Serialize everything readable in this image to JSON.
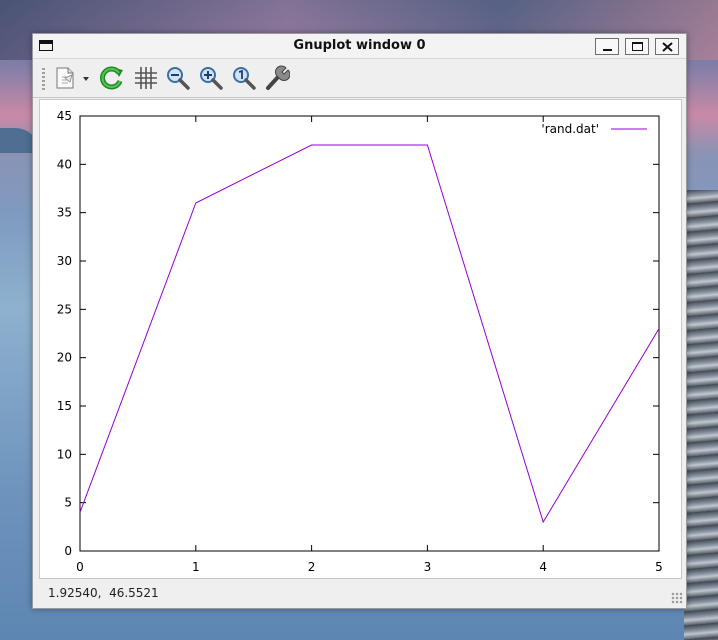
{
  "window": {
    "title": "Gnuplot window 0",
    "controls": [
      "minimize",
      "maximize",
      "close"
    ]
  },
  "toolbar": {
    "items": [
      {
        "name": "export-icon",
        "label": "Export"
      },
      {
        "name": "replot-icon",
        "label": "Replot"
      },
      {
        "name": "grid-icon",
        "label": "Grid"
      },
      {
        "name": "zoom-previous-icon",
        "label": "Previous zoom"
      },
      {
        "name": "zoom-next-icon",
        "label": "Next zoom"
      },
      {
        "name": "zoom-autoscale-icon",
        "label": "Autoscale"
      },
      {
        "name": "settings-icon",
        "label": "Settings"
      }
    ]
  },
  "chart_data": {
    "type": "line",
    "x": [
      0,
      1,
      2,
      3,
      4,
      5
    ],
    "series": [
      {
        "name": "'rand.dat'",
        "values": [
          4,
          36,
          42,
          42,
          3,
          23
        ],
        "color": "#9400d3"
      }
    ],
    "xlim": [
      0,
      5
    ],
    "ylim": [
      0,
      45
    ],
    "xticks": [
      "0",
      "1",
      "2",
      "3",
      "4",
      "5"
    ],
    "yticks": [
      "0",
      "5",
      "10",
      "15",
      "20",
      "25",
      "30",
      "35",
      "40",
      "45"
    ],
    "xlabel": "",
    "ylabel": "",
    "title": "",
    "grid": false,
    "legend_position": "top-right"
  },
  "status": {
    "coordinates": "1.92540,  46.5521"
  }
}
